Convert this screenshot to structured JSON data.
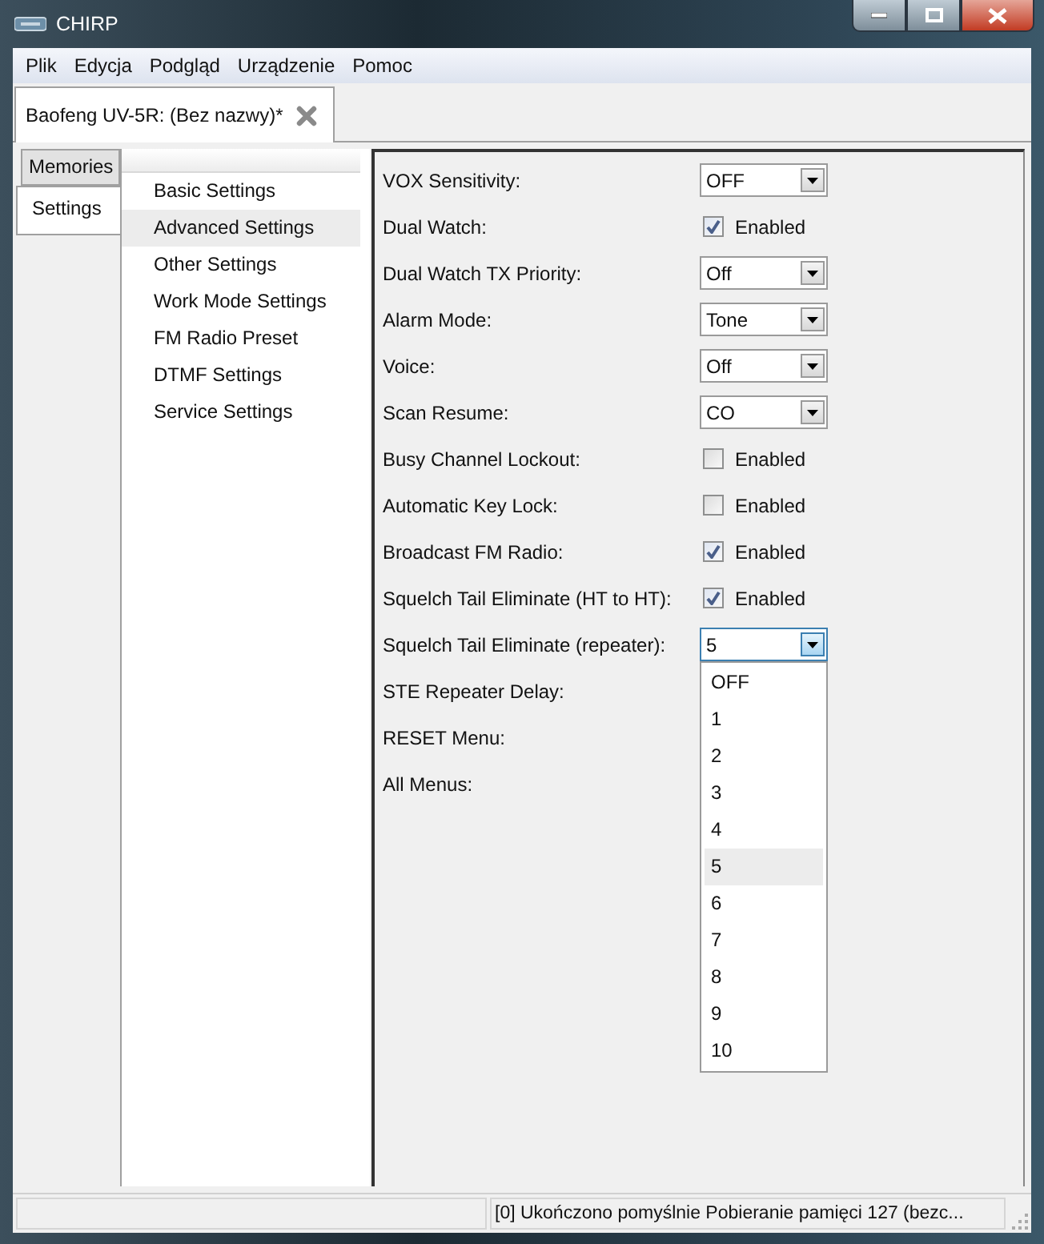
{
  "window": {
    "title": "CHIRP"
  },
  "menu": [
    "Plik",
    "Edycja",
    "Podgląd",
    "Urządzenie",
    "Pomoc"
  ],
  "document_tab": {
    "label": "Baofeng UV-5R: (Bez nazwy)*",
    "closable": true
  },
  "side_tabs": [
    {
      "label": "Memories",
      "selected": false
    },
    {
      "label": "Settings",
      "selected": true
    }
  ],
  "categories": [
    {
      "label": "Basic Settings",
      "selected": false
    },
    {
      "label": "Advanced Settings",
      "selected": true
    },
    {
      "label": "Other Settings",
      "selected": false
    },
    {
      "label": "Work Mode Settings",
      "selected": false
    },
    {
      "label": "FM Radio Preset",
      "selected": false
    },
    {
      "label": "DTMF Settings",
      "selected": false
    },
    {
      "label": "Service Settings",
      "selected": false
    }
  ],
  "settings": [
    {
      "label": "VOX Sensitivity:",
      "kind": "select",
      "value": "OFF"
    },
    {
      "label": "Dual Watch:",
      "kind": "checkbox",
      "text": "Enabled",
      "checked": true
    },
    {
      "label": "Dual Watch TX Priority:",
      "kind": "select",
      "value": "Off"
    },
    {
      "label": "Alarm Mode:",
      "kind": "select",
      "value": "Tone"
    },
    {
      "label": "Voice:",
      "kind": "select",
      "value": "Off"
    },
    {
      "label": "Scan Resume:",
      "kind": "select",
      "value": "CO"
    },
    {
      "label": "Busy Channel Lockout:",
      "kind": "checkbox",
      "text": "Enabled",
      "checked": false
    },
    {
      "label": "Automatic Key Lock:",
      "kind": "checkbox",
      "text": "Enabled",
      "checked": false
    },
    {
      "label": "Broadcast FM Radio:",
      "kind": "checkbox",
      "text": "Enabled",
      "checked": true
    },
    {
      "label": "Squelch Tail Eliminate (HT to HT):",
      "kind": "checkbox",
      "text": "Enabled",
      "checked": true
    },
    {
      "label": "Squelch Tail Eliminate (repeater):",
      "kind": "select",
      "value": "5",
      "expanded": true,
      "options": [
        {
          "label": "OFF",
          "selected": false
        },
        {
          "label": "1",
          "selected": false
        },
        {
          "label": "2",
          "selected": false
        },
        {
          "label": "3",
          "selected": false
        },
        {
          "label": "4",
          "selected": false
        },
        {
          "label": "5",
          "selected": true
        },
        {
          "label": "6",
          "selected": false
        },
        {
          "label": "7",
          "selected": false
        },
        {
          "label": "8",
          "selected": false
        },
        {
          "label": "9",
          "selected": false
        },
        {
          "label": "10",
          "selected": false
        }
      ]
    },
    {
      "label": "STE Repeater Delay:",
      "kind": "label"
    },
    {
      "label": "RESET Menu:",
      "kind": "label"
    },
    {
      "label": "All Menus:",
      "kind": "label"
    }
  ],
  "status_bar": {
    "message": "[0] Ukończono pomyślnie Pobieranie pamięci 127 (bezc..."
  }
}
